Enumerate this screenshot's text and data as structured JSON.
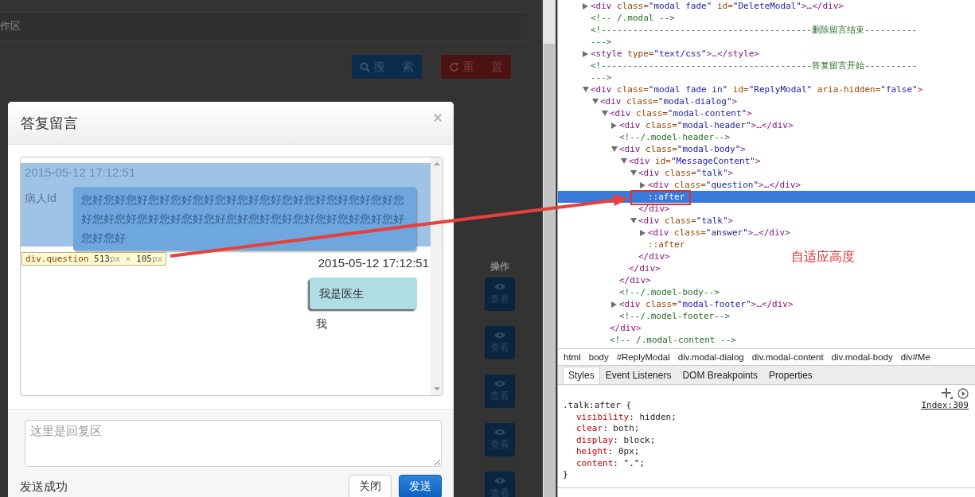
{
  "background": {
    "panel_title": "作区",
    "buttons": [
      {
        "kind": "search",
        "label": "搜 索"
      },
      {
        "kind": "reset",
        "label": "重 置"
      }
    ],
    "table": {
      "column": "操作",
      "row_buttons": [
        "查看",
        "查看",
        "查看",
        "查看",
        "查看"
      ]
    }
  },
  "modal": {
    "title": "答复留言",
    "close": "×",
    "messages": [
      {
        "kind": "question",
        "time": "2015-05-12 17:12:51",
        "sender": "病人Id",
        "text": "您好您好您好您好您好您好您好您好您好您好您好您好您好您好您好您好您好您好您好您好您好您好您好您好您好您好您好您好您好您好您好"
      },
      {
        "kind": "answer",
        "time": "2015-05-12 17:12:51",
        "text": "我是医生",
        "sender": "我"
      }
    ],
    "inspect_tooltip": [
      {
        "kind": "selector",
        "text": "div.question"
      },
      {
        "kind": "number",
        "text": " 513"
      },
      {
        "kind": "unit",
        "text": "px"
      },
      {
        "kind": "sep",
        "text": " × "
      },
      {
        "kind": "number",
        "text": "105"
      },
      {
        "kind": "unit",
        "text": "px"
      }
    ],
    "reply_field": {
      "placeholder": "这里是回复区"
    },
    "status": "发送成功",
    "buttons": [
      {
        "kind": "default",
        "label": "关闭"
      },
      {
        "kind": "primary",
        "label": "发送"
      }
    ]
  },
  "devtools": {
    "dom_tree": [
      {
        "expanded": false,
        "selected": false,
        "parts": [
          {
            "kind": "tag",
            "text": "<div"
          },
          {
            "kind": "attr",
            "text": " class="
          },
          {
            "kind": "value",
            "text": "\"modal fade\""
          },
          {
            "kind": "attr",
            "text": " id="
          },
          {
            "kind": "value",
            "text": "\"DeleteModal\""
          },
          {
            "kind": "tag",
            "text": ">…</div>"
          }
        ]
      },
      {
        "selected": false,
        "parts": [
          {
            "kind": "comment",
            "text": "<!-- /.modal -->"
          }
        ]
      },
      {
        "selected": false,
        "parts": [
          {
            "kind": "comment",
            "text": "<!----------------------------------------删除留言结束----------\n--->"
          }
        ]
      },
      {
        "expanded": false,
        "selected": false,
        "parts": [
          {
            "kind": "tag",
            "text": "<style"
          },
          {
            "kind": "attr",
            "text": " type="
          },
          {
            "kind": "value",
            "text": "\"text/css\""
          },
          {
            "kind": "tag",
            "text": ">…</style>"
          }
        ]
      },
      {
        "selected": false,
        "parts": [
          {
            "kind": "comment",
            "text": "<!----------------------------------------答复留言开始----------\n--->"
          }
        ]
      },
      {
        "expanded": true,
        "selected": false,
        "parts": [
          {
            "kind": "tag",
            "text": "<div"
          },
          {
            "kind": "attr",
            "text": " class="
          },
          {
            "kind": "value",
            "text": "\"modal fade in\""
          },
          {
            "kind": "attr",
            "text": " id="
          },
          {
            "kind": "value",
            "text": "\"ReplyModal\""
          },
          {
            "kind": "attr",
            "text": " aria-hidden="
          },
          {
            "kind": "value",
            "text": "\"false\""
          },
          {
            "kind": "tag",
            "text": ">"
          }
        ],
        "children": [
          {
            "expanded": true,
            "selected": false,
            "parts": [
              {
                "kind": "tag",
                "text": "<div"
              },
              {
                "kind": "attr",
                "text": " class="
              },
              {
                "kind": "value",
                "text": "\"modal-dialog\""
              },
              {
                "kind": "tag",
                "text": ">"
              }
            ],
            "children": [
              {
                "expanded": true,
                "selected": false,
                "parts": [
                  {
                    "kind": "tag",
                    "text": "<div"
                  },
                  {
                    "kind": "attr",
                    "text": " class="
                  },
                  {
                    "kind": "value",
                    "text": "\"modal-content\""
                  },
                  {
                    "kind": "tag",
                    "text": ">"
                  }
                ],
                "closing": [
                  {
                    "kind": "tag",
                    "text": "</div>"
                  }
                ],
                "children": [
                  {
                    "expanded": false,
                    "selected": false,
                    "parts": [
                      {
                        "kind": "tag",
                        "text": "<div"
                      },
                      {
                        "kind": "attr",
                        "text": " class="
                      },
                      {
                        "kind": "value",
                        "text": "\"modal-header\""
                      },
                      {
                        "kind": "tag",
                        "text": ">…</div>"
                      }
                    ]
                  },
                  {
                    "selected": false,
                    "parts": [
                      {
                        "kind": "comment",
                        "text": "<!--/.model-header-->"
                      }
                    ]
                  },
                  {
                    "expanded": true,
                    "selected": false,
                    "parts": [
                      {
                        "kind": "tag",
                        "text": "<div"
                      },
                      {
                        "kind": "attr",
                        "text": " class="
                      },
                      {
                        "kind": "value",
                        "text": "\"modal-body\""
                      },
                      {
                        "kind": "tag",
                        "text": ">"
                      }
                    ],
                    "closing": [
                      {
                        "kind": "tag",
                        "text": "</div>"
                      }
                    ],
                    "children": [
                      {
                        "expanded": true,
                        "selected": false,
                        "parts": [
                          {
                            "kind": "tag",
                            "text": "<div"
                          },
                          {
                            "kind": "attr",
                            "text": " id="
                          },
                          {
                            "kind": "value",
                            "text": "\"MessageContent\""
                          },
                          {
                            "kind": "tag",
                            "text": ">"
                          }
                        ],
                        "closing": [
                          {
                            "kind": "tag",
                            "text": "</div>"
                          }
                        ],
                        "children": [
                          {
                            "expanded": true,
                            "selected": false,
                            "parts": [
                              {
                                "kind": "tag",
                                "text": "<div"
                              },
                              {
                                "kind": "attr",
                                "text": " class="
                              },
                              {
                                "kind": "value",
                                "text": "\"talk\""
                              },
                              {
                                "kind": "tag",
                                "text": ">"
                              }
                            ],
                            "closing": [
                              {
                                "kind": "tag",
                                "text": "</div>"
                              }
                            ],
                            "children": [
                              {
                                "expanded": false,
                                "selected": false,
                                "parts": [
                                  {
                                    "kind": "tag",
                                    "text": "<div"
                                  },
                                  {
                                    "kind": "attr",
                                    "text": " class="
                                  },
                                  {
                                    "kind": "value",
                                    "text": "\"question\""
                                  },
                                  {
                                    "kind": "tag",
                                    "text": ">…</div>"
                                  }
                                ]
                              },
                              {
                                "selected": true,
                                "parts": [
                                  {
                                    "kind": "pseudo",
                                    "text": "::after"
                                  }
                                ]
                              }
                            ]
                          },
                          {
                            "expanded": true,
                            "selected": false,
                            "parts": [
                              {
                                "kind": "tag",
                                "text": "<div"
                              },
                              {
                                "kind": "attr",
                                "text": " class="
                              },
                              {
                                "kind": "value",
                                "text": "\"talk\""
                              },
                              {
                                "kind": "tag",
                                "text": ">"
                              }
                            ],
                            "closing": [
                              {
                                "kind": "tag",
                                "text": "</div>"
                              }
                            ],
                            "children": [
                              {
                                "expanded": false,
                                "selected": false,
                                "parts": [
                                  {
                                    "kind": "tag",
                                    "text": "<div"
                                  },
                                  {
                                    "kind": "attr",
                                    "text": " class="
                                  },
                                  {
                                    "kind": "value",
                                    "text": "\"answer\""
                                  },
                                  {
                                    "kind": "tag",
                                    "text": ">…</div>"
                                  }
                                ]
                              },
                              {
                                "selected": false,
                                "parts": [
                                  {
                                    "kind": "pseudo",
                                    "text": "::after"
                                  }
                                ]
                              }
                            ]
                          }
                        ]
                      }
                    ]
                  },
                  {
                    "selected": false,
                    "parts": [
                      {
                        "kind": "comment",
                        "text": "<!--/.model-body-->"
                      }
                    ]
                  },
                  {
                    "expanded": false,
                    "selected": false,
                    "parts": [
                      {
                        "kind": "tag",
                        "text": "<div"
                      },
                      {
                        "kind": "attr",
                        "text": " class="
                      },
                      {
                        "kind": "value",
                        "text": "\"modal-footer\""
                      },
                      {
                        "kind": "tag",
                        "text": ">…</div>"
                      }
                    ]
                  },
                  {
                    "selected": false,
                    "parts": [
                      {
                        "kind": "comment",
                        "text": "<!--/.model-footer-->"
                      }
                    ]
                  }
                ]
              },
              {
                "selected": false,
                "parts": [
                  {
                    "kind": "comment",
                    "text": "<!-- /.modal-content -->"
                  }
                ]
              }
            ]
          }
        ]
      }
    ],
    "annotation": "自适应高度",
    "breadcrumbs": [
      "html",
      "body",
      "#ReplyModal",
      "div.modal-dialog",
      "div.modal-content",
      "div.modal-body",
      "div#Me"
    ],
    "tabs": [
      {
        "label": "Styles",
        "selected": true
      },
      {
        "label": "Event Listeners",
        "selected": false
      },
      {
        "label": "DOM Breakpoints",
        "selected": false
      },
      {
        "label": "Properties",
        "selected": false
      }
    ],
    "style_rule": {
      "selector": ".talk:after {",
      "source": "Index:309",
      "properties": [
        {
          "name": "visibility",
          "rest": ": hidden;"
        },
        {
          "name": "clear",
          "rest": ": both;"
        },
        {
          "name": "display",
          "rest": ": block;"
        },
        {
          "name": "height",
          "rest": ": 0px;"
        },
        {
          "name": "content",
          "rest": ": \".\";"
        }
      ],
      "close": "}"
    }
  }
}
